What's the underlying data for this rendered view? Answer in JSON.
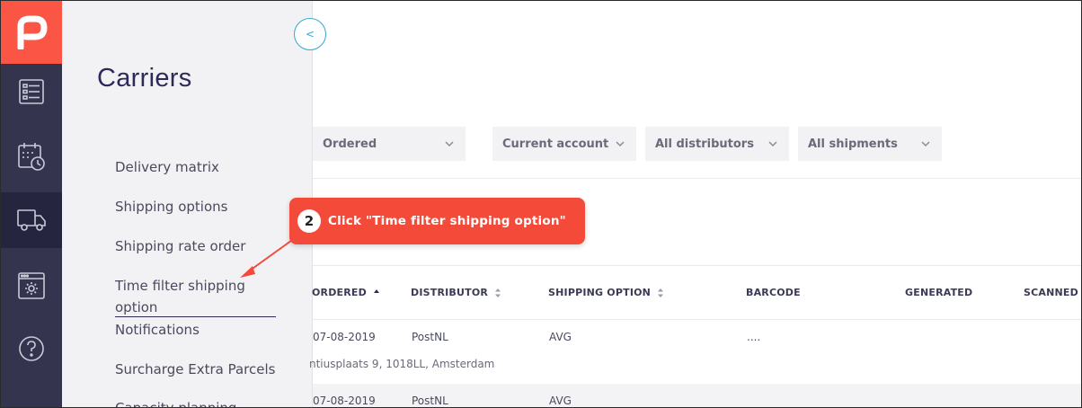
{
  "app": {
    "accent_color": "#fb5545",
    "rail_color": "#34344f",
    "link_color": "#31a8d8",
    "logo_icon": "parcel-logo-icon"
  },
  "rail": {
    "items": [
      {
        "icon": "list-icon",
        "active": false
      },
      {
        "icon": "calendar-clock-icon",
        "active": false
      },
      {
        "icon": "truck-icon",
        "active": true
      },
      {
        "icon": "settings-window-icon",
        "active": false
      },
      {
        "icon": "help-icon",
        "active": false
      }
    ]
  },
  "subnav": {
    "title": "Carriers",
    "collapse_label": "<",
    "items": [
      "Delivery matrix",
      "Shipping options",
      "Shipping rate order",
      "Time filter shipping",
      "option",
      "Notifications",
      "Surcharge Extra Parcels",
      "Capacity planning"
    ]
  },
  "filters": {
    "status": "Ordered",
    "account": "Current account",
    "distributors": "All distributors",
    "shipments": "All shipments"
  },
  "table": {
    "headers": {
      "ordered": "ORDERED",
      "distributor": "DISTRIBUTOR",
      "shipping_option": "SHIPPING OPTION",
      "barcode": "BARCODE",
      "generated": "GENERATED",
      "scanned": "SCANNED"
    },
    "rows": [
      {
        "ordered": "07-08-2019",
        "distributor": "PostNL",
        "shipping_option": "AVG",
        "barcode": "....",
        "address": "ntiusplaats 9, 1018LL, Amsterdam"
      },
      {
        "ordered": "07-08-2019",
        "distributor": "PostNL",
        "shipping_option": "AVG",
        "barcode": "....",
        "address": ""
      }
    ]
  },
  "callout": {
    "step": "2",
    "text": "Click \"Time filter shipping option\"",
    "color": "#f44a3a"
  }
}
